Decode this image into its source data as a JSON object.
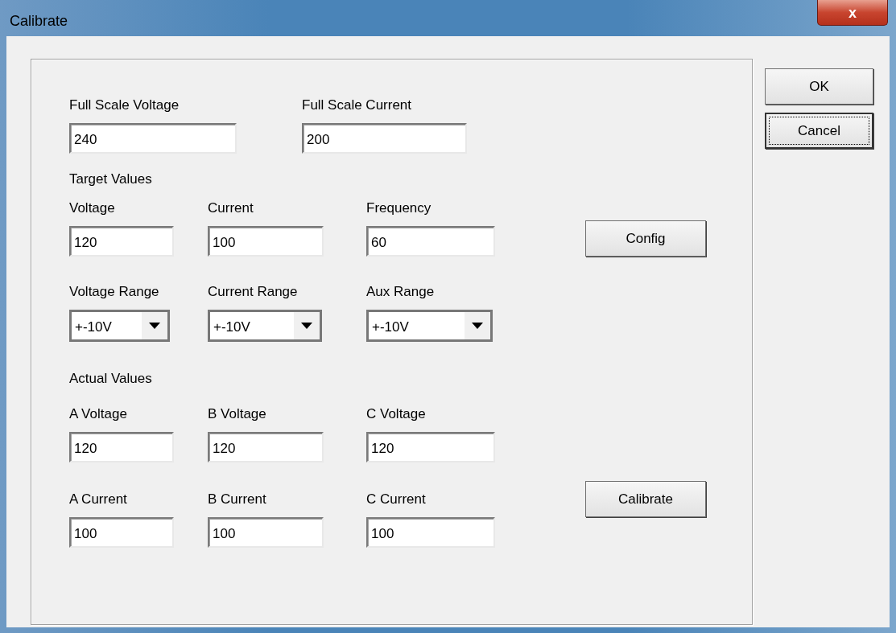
{
  "window": {
    "title": "Calibrate",
    "close_label": "x"
  },
  "dialog_buttons": [
    {
      "label": "OK",
      "focused": false
    },
    {
      "label": "Cancel",
      "focused": true
    }
  ],
  "rows": [
    {
      "kind": "fields",
      "items": [
        {
          "label": "Full Scale Voltage",
          "value": "240"
        },
        {
          "label": "Full Scale Current",
          "value": "200"
        }
      ]
    },
    {
      "kind": "heading",
      "text": "Target Values"
    },
    {
      "kind": "fields",
      "items": [
        {
          "label": "Voltage",
          "value": "120"
        },
        {
          "label": "Current",
          "value": "100"
        },
        {
          "label": "Frequency",
          "value": "60"
        }
      ],
      "action": "Config"
    },
    {
      "kind": "combos",
      "items": [
        {
          "label": "Voltage Range",
          "value": "+-10V"
        },
        {
          "label": "Current Range",
          "value": "+-10V"
        },
        {
          "label": "Aux Range",
          "value": "+-10V"
        }
      ]
    },
    {
      "kind": "heading",
      "text": "Actual Values"
    },
    {
      "kind": "fields",
      "items": [
        {
          "label": "A Voltage",
          "value": "120"
        },
        {
          "label": "B Voltage",
          "value": "120"
        },
        {
          "label": "C Voltage",
          "value": "120"
        }
      ]
    },
    {
      "kind": "fields",
      "items": [
        {
          "label": "A Current",
          "value": "100"
        },
        {
          "label": "B Current",
          "value": "100"
        },
        {
          "label": "C Current",
          "value": "100"
        }
      ],
      "action": "Calibrate"
    }
  ]
}
